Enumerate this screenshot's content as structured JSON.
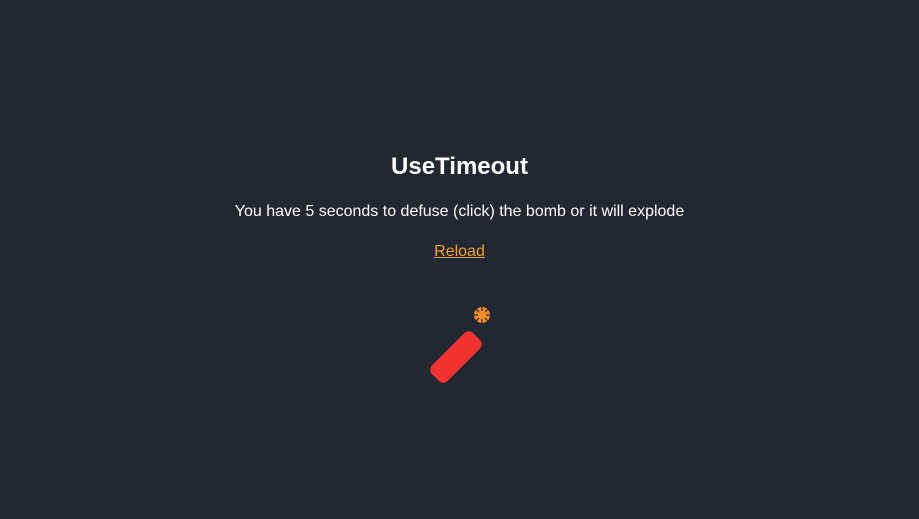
{
  "page": {
    "title": "UseTimeout",
    "description": "You have 5 seconds to defuse (click) the bomb or it will explode",
    "reload_label": "Reload"
  },
  "bomb": {
    "icon": "bomb-icon",
    "body_color": "#f23131",
    "spark_color": "#f78b2a"
  },
  "colors": {
    "background": "#222831",
    "text": "#ffffff",
    "link": "#f5a023"
  }
}
